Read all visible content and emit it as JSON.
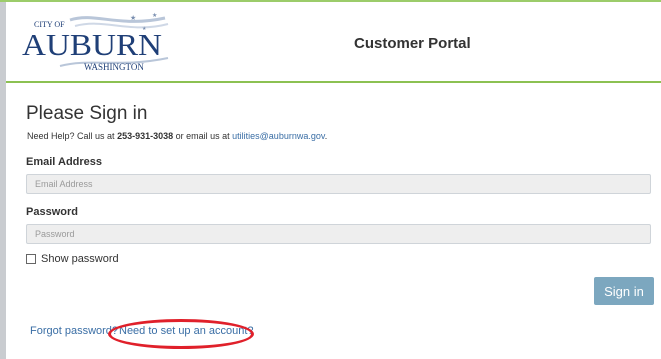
{
  "header": {
    "logo": {
      "city_of": "CITY OF",
      "name": "AUBURN",
      "state": "WASHINGTON"
    },
    "portal_title": "Customer Portal"
  },
  "signin": {
    "heading": "Please Sign in",
    "help": {
      "prefix": "Need Help? Call us at ",
      "phone": "253-931-3038",
      "middle": " or email us at ",
      "email": "utilities@auburnwa.gov",
      "suffix": "."
    },
    "email_label": "Email Address",
    "email_placeholder": "Email Address",
    "email_value": "",
    "password_label": "Password",
    "password_placeholder": "Password",
    "password_value": "",
    "show_password_label": "Show password",
    "signin_button": "Sign in",
    "forgot_link": "Forgot password?",
    "setup_link": "Need to set up an account?"
  },
  "colors": {
    "accent_green": "#8cc152",
    "button_blue": "#7ca7bf",
    "link_blue": "#3a6ea5",
    "annotation_red": "#e0202a",
    "logo_navy": "#1f3f77"
  },
  "icons": {
    "checkbox": "checkbox-icon",
    "logo": "auburn-logo-icon"
  }
}
